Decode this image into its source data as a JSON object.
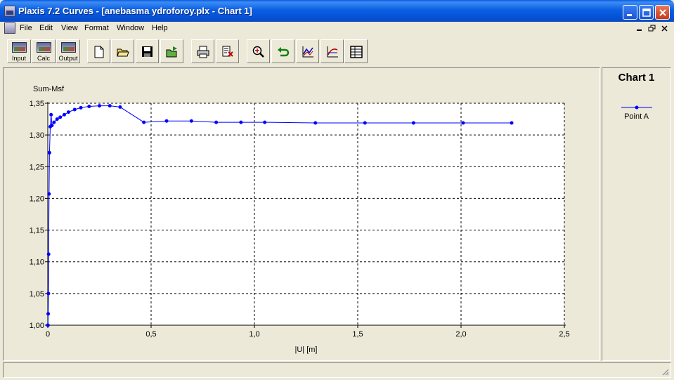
{
  "window": {
    "title": "Plaxis 7.2 Curves - [anebasma ydroforoy.plx - Chart 1]"
  },
  "menu": {
    "items": [
      "File",
      "Edit",
      "View",
      "Format",
      "Window",
      "Help"
    ]
  },
  "toolbar": {
    "input_label": "Input",
    "calc_label": "Calc",
    "output_label": "Output",
    "icons": [
      "new-document-icon",
      "open-folder-icon",
      "save-disk-icon",
      "open-project-icon",
      "print-icon",
      "print-setup-icon",
      "zoom-in-icon",
      "undo-zoom-icon",
      "chart-settings-icon",
      "curve-settings-icon",
      "table-icon"
    ]
  },
  "legend": {
    "title": "Chart 1",
    "series_label": "Point A"
  },
  "colors": {
    "series": "#0000ff",
    "titlebar": "#0a5ce0",
    "close": "#c83a18"
  },
  "chart_data": {
    "type": "line",
    "title": "",
    "xlabel": "|U| [m]",
    "ylabel": "Sum-Msf",
    "xlim": [
      0,
      2.5
    ],
    "ylim": [
      1.0,
      1.35
    ],
    "xticks": [
      0,
      0.5,
      1.0,
      1.5,
      2.0,
      2.5
    ],
    "xtick_labels": [
      "0",
      "0,5",
      "1,0",
      "1,5",
      "2,0",
      "2,5"
    ],
    "yticks": [
      1.0,
      1.05,
      1.1,
      1.15,
      1.2,
      1.25,
      1.3,
      1.35
    ],
    "ytick_labels": [
      "1,00",
      "1,05",
      "1,10",
      "1,15",
      "1,20",
      "1,25",
      "1,30",
      "1,35"
    ],
    "grid": true,
    "legend_position": "right-panel",
    "series": [
      {
        "name": "Point A",
        "x": [
          0.0,
          0.001,
          0.002,
          0.003,
          0.004,
          0.006,
          0.008,
          0.012,
          0.016,
          0.02,
          0.03,
          0.045,
          0.06,
          0.08,
          0.1,
          0.13,
          0.16,
          0.2,
          0.25,
          0.3,
          0.35,
          0.465,
          0.575,
          0.695,
          0.815,
          0.935,
          1.05,
          1.295,
          1.535,
          1.77,
          2.01,
          2.245
        ],
        "y": [
          1.0,
          1.0,
          1.018,
          1.05,
          1.112,
          1.207,
          1.272,
          1.313,
          1.332,
          1.315,
          1.32,
          1.325,
          1.328,
          1.332,
          1.336,
          1.34,
          1.343,
          1.345,
          1.346,
          1.346,
          1.344,
          1.32,
          1.322,
          1.322,
          1.32,
          1.32,
          1.32,
          1.319,
          1.319,
          1.319,
          1.319,
          1.319
        ]
      }
    ]
  }
}
